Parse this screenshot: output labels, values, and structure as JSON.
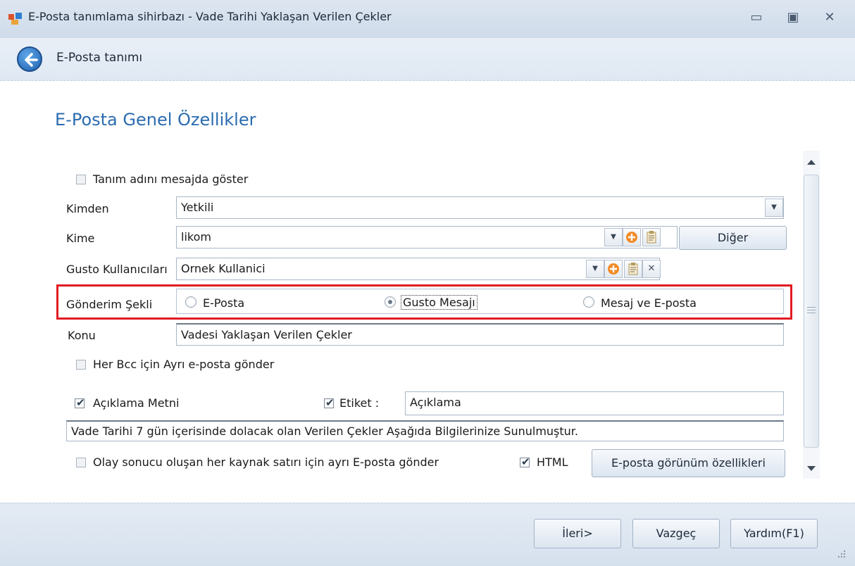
{
  "window": {
    "title": "E-Posta tanımlama sihirbazı - Vade Tarihi Yaklaşan Verilen Çekler",
    "minimize": "▭",
    "maximize": "▣",
    "close": "✕"
  },
  "header": {
    "title": "E-Posta tanımı"
  },
  "section": {
    "title": "E-Posta Genel Özellikler"
  },
  "form": {
    "show_name": {
      "label": "Tanım adını mesajda göster",
      "checked": false
    },
    "kimden": {
      "label": "Kimden",
      "value": "Yetkili"
    },
    "kime": {
      "label": "Kime",
      "value": "likom",
      "other_button": "Diğer"
    },
    "gusto_users": {
      "label": "Gusto Kullanıcıları",
      "value": "Ornek Kullanici"
    },
    "send_type": {
      "label": "Gönderim Şekli",
      "options": [
        "E-Posta",
        "Gusto Mesajı",
        "Mesaj ve E-posta"
      ],
      "selected": "Gusto Mesajı",
      "highlight_color": "#e11b22"
    },
    "konu": {
      "label": "Konu",
      "value": "Vadesi Yaklaşan Verilen Çekler"
    },
    "bcc": {
      "label": "Her Bcc için Ayrı e-posta gönder",
      "checked": false
    },
    "desc_text": {
      "label": "Açıklama Metni",
      "checked": true
    },
    "tag": {
      "label": "Etiket :",
      "checked": true,
      "value": "Açıklama"
    },
    "message": "Vade Tarihi 7 gün içerisinde dolacak olan  Verilen Çekler Aşağıda Bilgilerinize Sunulmuştur.",
    "per_row": {
      "label": "Olay sonucu oluşan her kaynak satırı için ayrı E-posta  gönder",
      "checked": false
    },
    "html": {
      "label": "HTML",
      "checked": true
    },
    "view_props_button": "E-posta görünüm özellikleri"
  },
  "footer": {
    "next": "İleri>",
    "cancel": "Vazgeç",
    "help": "Yardım(F1)"
  },
  "colors": {
    "accent": "#2b6cb0",
    "highlight": "#e11b22"
  }
}
